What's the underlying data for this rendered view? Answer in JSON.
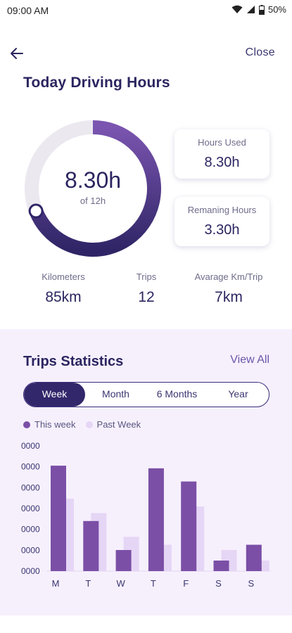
{
  "status_bar": {
    "time": "09:00 AM",
    "battery": "50%"
  },
  "header": {
    "close_label": "Close",
    "title": "Today Driving Hours"
  },
  "donut": {
    "value": "8.30h",
    "sub": "of 12h",
    "progress": 0.69,
    "track_color": "#ebe8f0",
    "fill_start": "#7b55b0",
    "fill_end": "#2f2566"
  },
  "cards": [
    {
      "label": "Hours Used",
      "value": "8.30h"
    },
    {
      "label": "Remaning Hours",
      "value": "3.30h"
    }
  ],
  "stats": [
    {
      "label": "Kilometers",
      "value": "85km"
    },
    {
      "label": "Trips",
      "value": "12"
    },
    {
      "label": "Avarage Km/Trip",
      "value": "7km"
    }
  ],
  "trips": {
    "title": "Trips Statistics",
    "view_all": "View All",
    "tabs": [
      "Week",
      "Month",
      "6 Months",
      "Year"
    ],
    "active_tab": "Week",
    "legend": [
      {
        "label": "This week",
        "color": "#7b4fa6"
      },
      {
        "label": "Past Week",
        "color": "#e6d6f5"
      }
    ]
  },
  "chart_data": {
    "type": "bar",
    "categories": [
      "M",
      "T",
      "W",
      "T",
      "F",
      "S",
      "S"
    ],
    "series": [
      {
        "name": "This week",
        "values": [
          8.0,
          3.8,
          1.6,
          7.8,
          6.8,
          0.8,
          2.0
        ],
        "color": "#7b4fa6"
      },
      {
        "name": "Past Week",
        "values": [
          5.5,
          4.4,
          2.6,
          2.0,
          4.9,
          1.6,
          0.8
        ],
        "color": "#e6d6f5"
      }
    ],
    "y_tick_labels": [
      "0000",
      "0000",
      "0000",
      "0000",
      "0000",
      "0000",
      "0000"
    ],
    "ylim": [
      0,
      9.5
    ]
  }
}
